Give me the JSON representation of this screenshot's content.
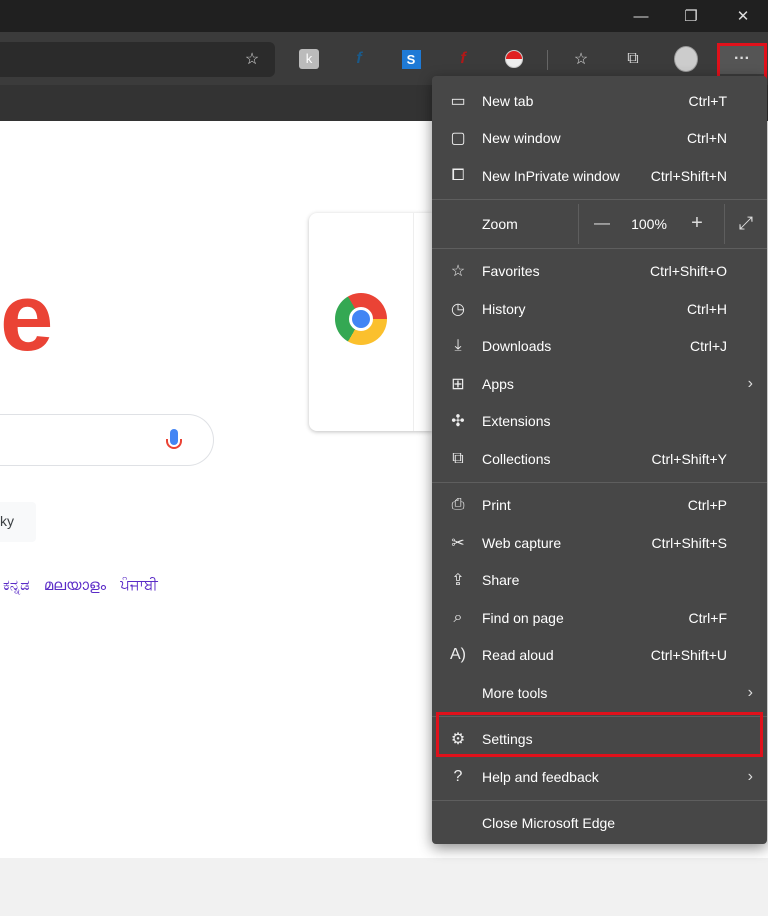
{
  "window": {
    "minimize": "—",
    "restore": "❐",
    "close": "✕"
  },
  "toolbar": {
    "more_label": "···"
  },
  "page": {
    "logo_fragment": "e",
    "lucky_fragment": "ky",
    "languages": [
      "ಕನ್ನಡ",
      "മലയാളം",
      "ਪੰਜਾਬੀ"
    ]
  },
  "menu": {
    "group1": [
      {
        "label": "New tab",
        "shortcut": "Ctrl+T",
        "icon": "new-tab-icon"
      },
      {
        "label": "New window",
        "shortcut": "Ctrl+N",
        "icon": "new-window-icon"
      },
      {
        "label": "New InPrivate window",
        "shortcut": "Ctrl+Shift+N",
        "icon": "inprivate-icon"
      }
    ],
    "zoom": {
      "label": "Zoom",
      "value": "100%",
      "minus": "—",
      "plus": "+"
    },
    "group2": [
      {
        "label": "Favorites",
        "shortcut": "Ctrl+Shift+O"
      },
      {
        "label": "History",
        "shortcut": "Ctrl+H"
      },
      {
        "label": "Downloads",
        "shortcut": "Ctrl+J"
      },
      {
        "label": "Apps",
        "shortcut": ""
      },
      {
        "label": "Extensions",
        "shortcut": ""
      },
      {
        "label": "Collections",
        "shortcut": "Ctrl+Shift+Y"
      }
    ],
    "group3": [
      {
        "label": "Print",
        "shortcut": "Ctrl+P"
      },
      {
        "label": "Web capture",
        "shortcut": "Ctrl+Shift+S"
      },
      {
        "label": "Share",
        "shortcut": ""
      },
      {
        "label": "Find on page",
        "shortcut": "Ctrl+F"
      },
      {
        "label": "Read aloud",
        "shortcut": "Ctrl+Shift+U"
      },
      {
        "label": "More tools",
        "shortcut": ""
      }
    ],
    "group4": [
      {
        "label": "Settings"
      },
      {
        "label": "Help and feedback"
      }
    ],
    "close": {
      "label": "Close Microsoft Edge"
    }
  },
  "colors": {
    "highlight": "#e0111b",
    "menu_bg": "#474747"
  }
}
